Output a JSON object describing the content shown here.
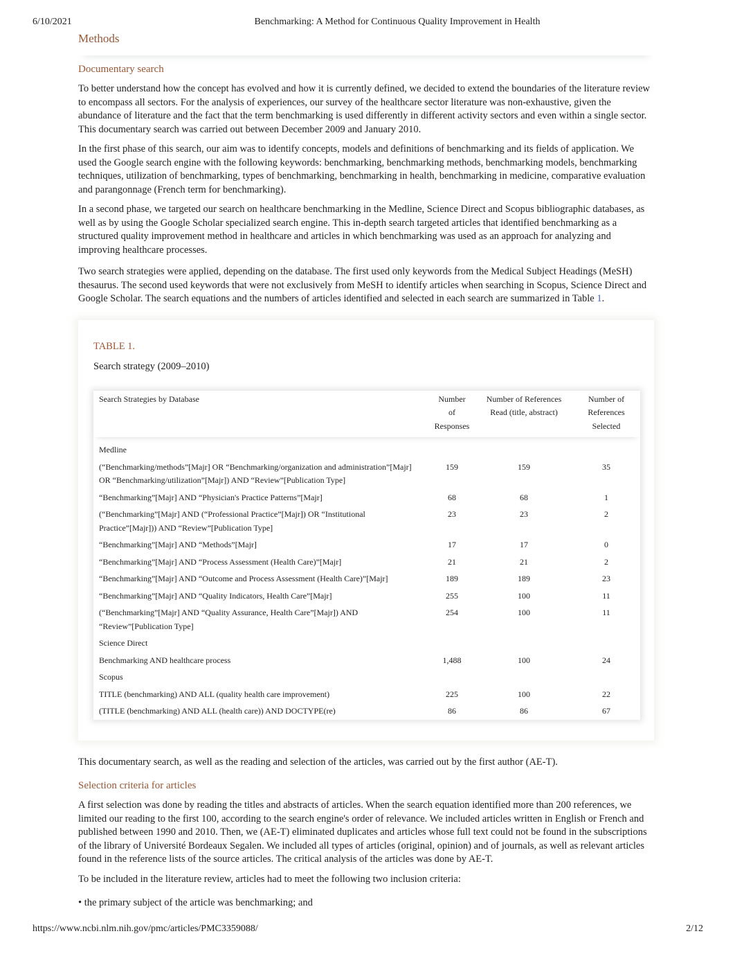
{
  "header": {
    "date": "6/10/2021",
    "title": "Benchmarking: A Method for Continuous Quality Improvement in Health"
  },
  "footer": {
    "url": "https://www.ncbi.nlm.nih.gov/pmc/articles/PMC3359088/",
    "page": "2/12"
  },
  "section": {
    "heading": "Methods",
    "sub1": "Documentary search",
    "p1": "To better understand how the concept has evolved and how it is currently defined, we decided to extend the boundaries of the literature review to encompass all sectors. For the analysis of experiences, our survey of the healthcare sector literature was non-exhaustive, given the abundance of literature and the fact that the term benchmarking is used differently in different activity sectors and even within a single sector. This documentary search was carried out between December 2009 and January 2010.",
    "p2": "In the first phase of this search, our aim was to identify concepts, models and definitions of benchmarking and its fields of application. We used the Google search engine with the following keywords: benchmarking, benchmarking methods, benchmarking models, benchmarking techniques, utilization of benchmarking, types of benchmarking, benchmarking in health, benchmarking in medicine, comparative evaluation and parangonnage  (French term for benchmarking).",
    "p3": "In a second phase, we targeted our search on healthcare benchmarking in the Medline, Science Direct and Scopus bibliographic databases, as well as by using the Google Scholar specialized search engine. This in-depth search targeted articles that identified benchmarking as a structured quality improvement method in healthcare and articles in which benchmarking was used as an approach for analyzing and improving healthcare processes.",
    "p4": "Two search strategies were applied, depending on the database. The first used only keywords from the Medical Subject Headings (MeSH) thesaurus. The second used keywords that were not exclusively from MeSH to identify articles when searching in Scopus, Science Direct and Google Scholar. The search equations and the numbers of articles identified and selected in each search are summarized in Table ",
    "p4_link": "1",
    "p4_end": ".",
    "p5": "This documentary search, as well as the reading and selection of the articles, was carried out by the first author (AE-T).",
    "sub2": "Selection criteria for articles",
    "p6": "A first selection was done by reading the titles and abstracts of articles. When the search equation identified more than 200 references, we limited our reading to the first 100, according to the search engine's order of relevance. We included articles written in English or French and published between 1990 and 2010. Then, we (AE-T) eliminated duplicates and articles whose full text could not be found in the subscriptions of the library of Université Bordeaux Segalen. We included all types of articles (original, opinion) and of journals, as well as relevant articles found in the reference lists of the source articles. The critical analysis of the articles was done by AE-T.",
    "p7": "To be included in the literature review, articles had to meet the following two inclusion criteria:",
    "p8": "• the primary subject of the article was benchmarking; and"
  },
  "table": {
    "label": "TABLE 1.",
    "caption": "Search strategy (2009–2010)",
    "columns": [
      "Search Strategies by Database",
      "Number of Responses",
      "Number of References Read (title, abstract)",
      "Number of References Selected"
    ],
    "rows": [
      {
        "group": "Medline"
      },
      {
        "cells": [
          "(“Benchmarking/methods”[Majr] OR “Benchmarking/organization and administration”[Majr] OR “Benchmarking/utilization”[Majr]) AND “Review”[Publication Type]",
          "159",
          "159",
          "35"
        ]
      },
      {
        "cells": [
          "“Benchmarking”[Majr] AND “Physician's Practice Patterns”[Majr]",
          "68",
          "68",
          "1"
        ]
      },
      {
        "cells": [
          "(“Benchmarking”[Majr] AND (“Professional Practice”[Majr]) OR “Institutional Practice”[Majr])) AND “Review”[Publication Type]",
          "23",
          "23",
          "2"
        ]
      },
      {
        "cells": [
          "“Benchmarking”[Majr] AND “Methods”[Majr]",
          "17",
          "17",
          "0"
        ]
      },
      {
        "cells": [
          "“Benchmarking”[Majr] AND “Process Assessment (Health Care)”[Majr]",
          "21",
          "21",
          "2"
        ]
      },
      {
        "cells": [
          "“Benchmarking”[Majr] AND “Outcome and Process Assessment (Health Care)”[Majr]",
          "189",
          "189",
          "23"
        ]
      },
      {
        "cells": [
          "“Benchmarking”[Majr] AND “Quality Indicators, Health Care”[Majr]",
          "255",
          "100",
          "11"
        ]
      },
      {
        "cells": [
          "(“Benchmarking”[Majr] AND “Quality Assurance, Health Care”[Majr]) AND “Review”[Publication Type]",
          "254",
          "100",
          "11"
        ]
      },
      {
        "group": "Science Direct"
      },
      {
        "cells": [
          "Benchmarking AND healthcare process",
          "1,488",
          "100",
          "24"
        ]
      },
      {
        "group": "Scopus"
      },
      {
        "cells": [
          "TITLE (benchmarking) AND ALL (quality health care improvement)",
          "225",
          "100",
          "22"
        ]
      },
      {
        "cells": [
          "(TITLE (benchmarking) AND ALL (health care)) AND DOCTYPE(re)",
          "86",
          "86",
          "67"
        ]
      }
    ]
  },
  "colors": {
    "heading": "#985735",
    "link": "#3a5fcd"
  }
}
